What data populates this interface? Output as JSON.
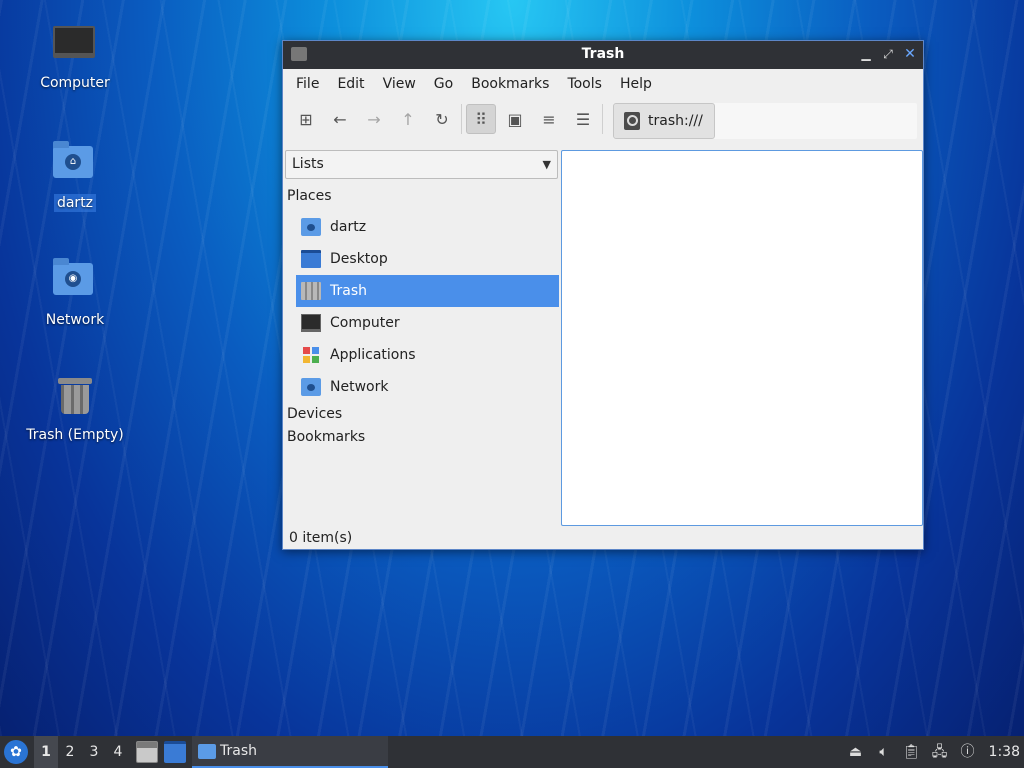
{
  "desktop": {
    "icons": [
      {
        "label": "Computer",
        "icon": "computer-icon"
      },
      {
        "label": "dartz",
        "icon": "home-folder-icon",
        "selected": true
      },
      {
        "label": "Network",
        "icon": "network-folder-icon"
      },
      {
        "label": "Trash (Empty)",
        "icon": "trash-icon"
      }
    ]
  },
  "window": {
    "title": "Trash",
    "controls": {
      "minimize": "▁",
      "maximize": "⤢",
      "close": "✕"
    },
    "menu": [
      "File",
      "Edit",
      "View",
      "Go",
      "Bookmarks",
      "Tools",
      "Help"
    ],
    "toolbar": {
      "new_tab": "⊞",
      "back": "←",
      "forward": "→",
      "up": "↑",
      "reload": "↻",
      "icon_view": "⠿",
      "thumbnail_view": "▣",
      "compact_view": "≡",
      "detailed_view": "☰",
      "location": "trash:///"
    },
    "side_mode": "Lists",
    "places_header": "Places",
    "places": [
      {
        "label": "dartz",
        "icon": "home-folder-icon"
      },
      {
        "label": "Desktop",
        "icon": "desktop-icon"
      },
      {
        "label": "Trash",
        "icon": "trash-icon",
        "selected": true
      },
      {
        "label": "Computer",
        "icon": "computer-icon"
      },
      {
        "label": "Applications",
        "icon": "applications-icon"
      },
      {
        "label": "Network",
        "icon": "network-folder-icon"
      }
    ],
    "devices_header": "Devices",
    "bookmarks_header": "Bookmarks",
    "status": "0 item(s)"
  },
  "taskbar": {
    "workspaces": [
      "1",
      "2",
      "3",
      "4"
    ],
    "active_workspace": "1",
    "task_label": "Trash",
    "clock": "1:38"
  },
  "colors": {
    "accent": "#4a8fea",
    "titlebar": "#2f3136",
    "taskbar": "#2f3136"
  }
}
